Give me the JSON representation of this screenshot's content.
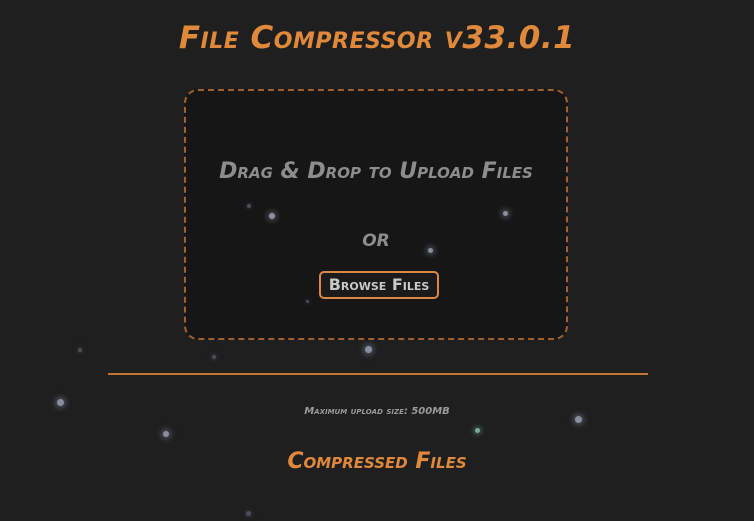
{
  "app": {
    "title": "File Compressor v33.0.1"
  },
  "dropzone": {
    "instruction": "Drag & Drop to Upload Files",
    "or_text": "OR",
    "browse_label": "Browse Files"
  },
  "info": {
    "max_upload": "Maximum upload size: 500MB"
  },
  "results": {
    "heading": "Compressed Files"
  },
  "colors": {
    "accent": "#e0893a",
    "background": "#1f1f1f",
    "dropzone_bg": "#161616",
    "muted_text": "#8d8d8d"
  }
}
